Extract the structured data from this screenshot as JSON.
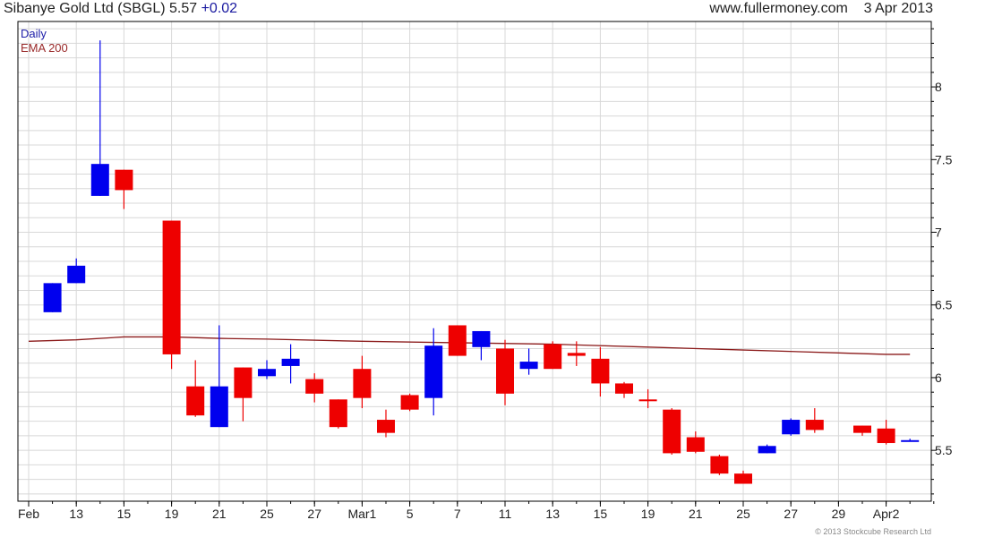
{
  "header": {
    "title": "Sibanye Gold Ltd (SBGL) 5.57",
    "change": "+0.02",
    "site": "www.fullermoney.com",
    "date": "3 Apr 2013"
  },
  "legend": {
    "daily": "Daily",
    "ema": "EMA 200"
  },
  "copyright": "© 2013 Stockcube Research Ltd",
  "colors": {
    "up": "#0000ee",
    "down": "#ee0000",
    "ema": "#8b1a1a",
    "grid": "#d8d8d8",
    "frame": "#000000"
  },
  "chart_data": {
    "type": "candlestick",
    "title": "Sibanye Gold Ltd (SBGL) 5.57 +0.02",
    "ylim": [
      5.15,
      8.45
    ],
    "y_ticks": [
      5.5,
      6,
      6.5,
      7,
      7.5,
      8
    ],
    "y_tick_labels": [
      "5.5",
      "6",
      "6.5",
      "7",
      "7.5",
      "8"
    ],
    "x_tick_labels": [
      {
        "day": 0,
        "label": "Feb"
      },
      {
        "day": 2,
        "label": "13"
      },
      {
        "day": 4,
        "label": "15"
      },
      {
        "day": 6,
        "label": "19"
      },
      {
        "day": 8,
        "label": "21"
      },
      {
        "day": 10,
        "label": "25"
      },
      {
        "day": 12,
        "label": "27"
      },
      {
        "day": 14,
        "label": "Mar1"
      },
      {
        "day": 16,
        "label": "5"
      },
      {
        "day": 18,
        "label": "7"
      },
      {
        "day": 20,
        "label": "11"
      },
      {
        "day": 22,
        "label": "13"
      },
      {
        "day": 24,
        "label": "15"
      },
      {
        "day": 26,
        "label": "19"
      },
      {
        "day": 28,
        "label": "21"
      },
      {
        "day": 30,
        "label": "25"
      },
      {
        "day": 32,
        "label": "27"
      },
      {
        "day": 34,
        "label": "29"
      },
      {
        "day": 36,
        "label": "Apr2"
      }
    ],
    "candles": [
      {
        "day": 1,
        "open": 6.45,
        "high": 6.65,
        "low": 6.45,
        "close": 6.65
      },
      {
        "day": 2,
        "open": 6.65,
        "high": 6.82,
        "low": 6.65,
        "close": 6.77
      },
      {
        "day": 3,
        "open": 7.25,
        "high": 8.32,
        "low": 7.25,
        "close": 7.47
      },
      {
        "day": 4,
        "open": 7.43,
        "high": 7.43,
        "low": 7.16,
        "close": 7.29
      },
      {
        "day": 6,
        "open": 7.08,
        "high": 7.08,
        "low": 6.06,
        "close": 6.16
      },
      {
        "day": 7,
        "open": 5.94,
        "high": 6.12,
        "low": 5.73,
        "close": 5.74
      },
      {
        "day": 8,
        "open": 5.66,
        "high": 6.36,
        "low": 5.66,
        "close": 5.94
      },
      {
        "day": 9,
        "open": 6.07,
        "high": 6.07,
        "low": 5.7,
        "close": 5.86
      },
      {
        "day": 10,
        "open": 6.01,
        "high": 6.12,
        "low": 5.99,
        "close": 6.06
      },
      {
        "day": 11,
        "open": 6.08,
        "high": 6.23,
        "low": 5.96,
        "close": 6.13
      },
      {
        "day": 12,
        "open": 5.99,
        "high": 6.03,
        "low": 5.83,
        "close": 5.89
      },
      {
        "day": 13,
        "open": 5.85,
        "high": 5.85,
        "low": 5.65,
        "close": 5.66
      },
      {
        "day": 14,
        "open": 6.06,
        "high": 6.15,
        "low": 5.79,
        "close": 5.86
      },
      {
        "day": 15,
        "open": 5.71,
        "high": 5.78,
        "low": 5.59,
        "close": 5.62
      },
      {
        "day": 16,
        "open": 5.88,
        "high": 5.89,
        "low": 5.77,
        "close": 5.78
      },
      {
        "day": 17,
        "open": 5.86,
        "high": 6.34,
        "low": 5.74,
        "close": 6.22
      },
      {
        "day": 18,
        "open": 6.36,
        "high": 6.36,
        "low": 6.15,
        "close": 6.15
      },
      {
        "day": 19,
        "open": 6.21,
        "high": 6.32,
        "low": 6.12,
        "close": 6.32
      },
      {
        "day": 20,
        "open": 6.2,
        "high": 6.26,
        "low": 5.81,
        "close": 5.89
      },
      {
        "day": 21,
        "open": 6.06,
        "high": 6.2,
        "low": 6.02,
        "close": 6.11
      },
      {
        "day": 22,
        "open": 6.23,
        "high": 6.25,
        "low": 6.06,
        "close": 6.06
      },
      {
        "day": 23,
        "open": 6.17,
        "high": 6.25,
        "low": 6.08,
        "close": 6.15
      },
      {
        "day": 24,
        "open": 6.13,
        "high": 6.21,
        "low": 5.87,
        "close": 5.96
      },
      {
        "day": 25,
        "open": 5.96,
        "high": 5.97,
        "low": 5.86,
        "close": 5.89
      },
      {
        "day": 26,
        "open": 5.85,
        "high": 5.92,
        "low": 5.79,
        "close": 5.84
      },
      {
        "day": 27,
        "open": 5.78,
        "high": 5.79,
        "low": 5.47,
        "close": 5.48
      },
      {
        "day": 28,
        "open": 5.59,
        "high": 5.63,
        "low": 5.48,
        "close": 5.49
      },
      {
        "day": 29,
        "open": 5.46,
        "high": 5.47,
        "low": 5.33,
        "close": 5.34
      },
      {
        "day": 30,
        "open": 5.34,
        "high": 5.36,
        "low": 5.27,
        "close": 5.27
      },
      {
        "day": 31,
        "open": 5.48,
        "high": 5.54,
        "low": 5.48,
        "close": 5.53
      },
      {
        "day": 32,
        "open": 5.61,
        "high": 5.72,
        "low": 5.6,
        "close": 5.71
      },
      {
        "day": 33,
        "open": 5.71,
        "high": 5.79,
        "low": 5.62,
        "close": 5.64
      },
      {
        "day": 35,
        "open": 5.67,
        "high": 5.67,
        "low": 5.6,
        "close": 5.62
      },
      {
        "day": 36,
        "open": 5.65,
        "high": 5.71,
        "low": 5.54,
        "close": 5.55
      },
      {
        "day": 37,
        "open": 5.56,
        "high": 5.58,
        "low": 5.56,
        "close": 5.57
      }
    ],
    "ema200": [
      {
        "day": 0,
        "value": 6.25
      },
      {
        "day": 2,
        "value": 6.26
      },
      {
        "day": 4,
        "value": 6.28
      },
      {
        "day": 6,
        "value": 6.28
      },
      {
        "day": 8,
        "value": 6.27
      },
      {
        "day": 10,
        "value": 6.265
      },
      {
        "day": 14,
        "value": 6.25
      },
      {
        "day": 18,
        "value": 6.24
      },
      {
        "day": 22,
        "value": 6.23
      },
      {
        "day": 26,
        "value": 6.21
      },
      {
        "day": 30,
        "value": 6.19
      },
      {
        "day": 34,
        "value": 6.17
      },
      {
        "day": 36,
        "value": 6.16
      },
      {
        "day": 37,
        "value": 6.16
      }
    ],
    "grid": true,
    "legend_position": "top-left"
  }
}
